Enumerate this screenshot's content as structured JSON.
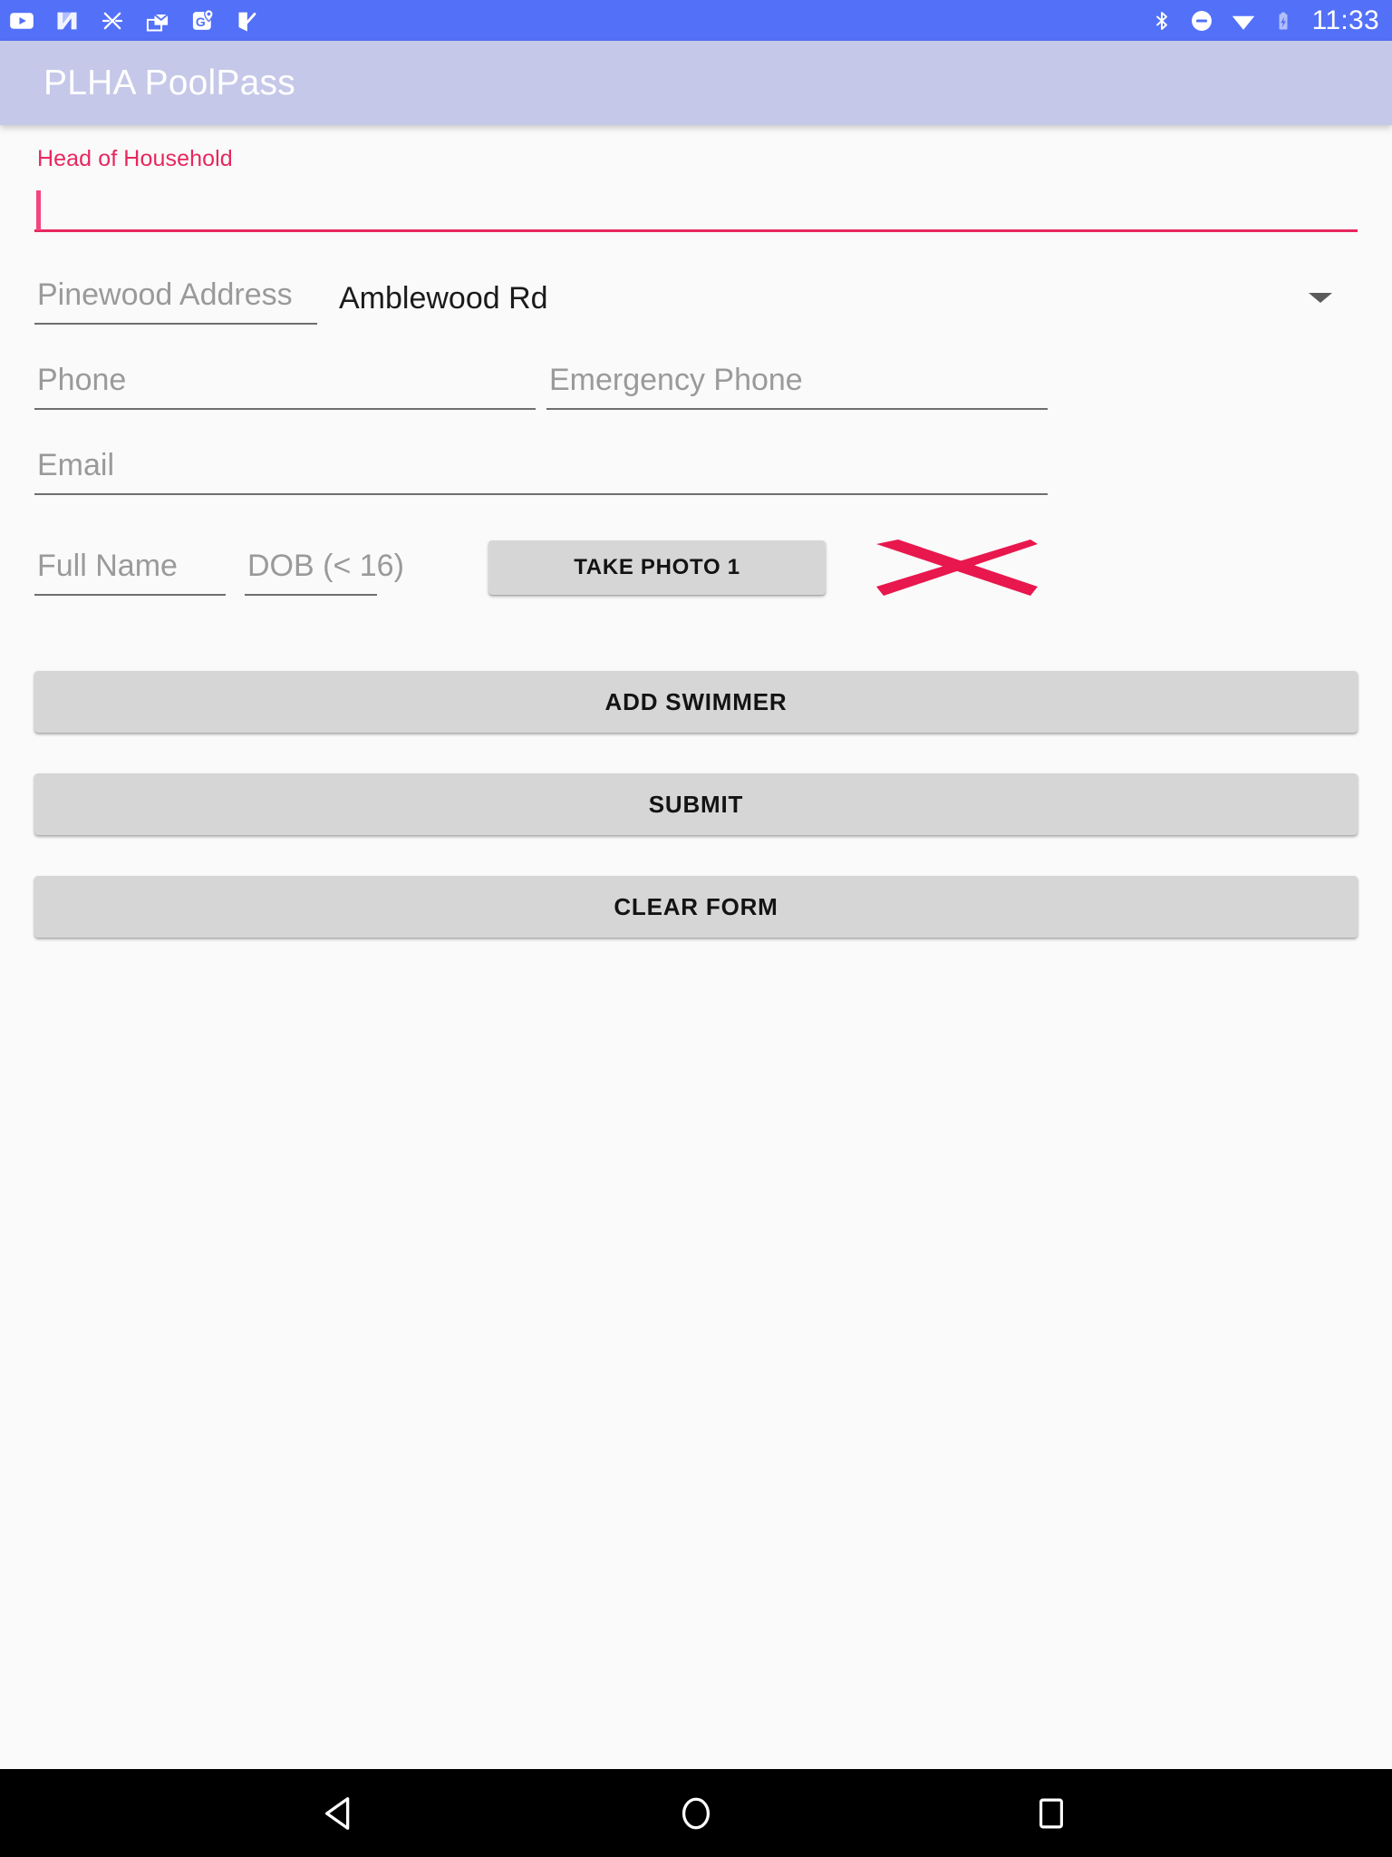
{
  "status_bar": {
    "background_color": "#5370F8",
    "time": "11:33",
    "left_icons": [
      "youtube-icon",
      "nova-n-icon",
      "crossed-x-icon",
      "mail-open-icon",
      "maps-pin-icon",
      "check-flag-icon"
    ],
    "right_icons": [
      "bluetooth-icon",
      "do-not-disturb-icon",
      "wifi-icon",
      "battery-charging-icon"
    ]
  },
  "app_bar": {
    "title": "PLHA PoolPass",
    "background_color": "#C5C8E8",
    "title_color": "#FFFFFF"
  },
  "form": {
    "head_of_household": {
      "label": "Head of Household",
      "value": "",
      "label_color": "#E8275E",
      "underline_color": "#E8275E",
      "focused": true
    },
    "address_number": {
      "placeholder": "Pinewood Address",
      "value": ""
    },
    "street_spinner": {
      "selected": "Amblewood Rd",
      "caret": "chevron-down-icon"
    },
    "phone": {
      "placeholder": "Phone",
      "value": ""
    },
    "emergency_phone": {
      "placeholder": "Emergency Phone",
      "value": ""
    },
    "email": {
      "placeholder": "Email",
      "value": ""
    },
    "swimmer_row": {
      "full_name": {
        "placeholder": "Full Name",
        "value": ""
      },
      "dob": {
        "placeholder": "DOB (< 16)",
        "value": ""
      },
      "take_photo_label": "TAKE PHOTO 1",
      "delete_icon": "delete-x-icon",
      "delete_icon_color": "#E8174D"
    }
  },
  "actions": {
    "add_swimmer": "ADD SWIMMER",
    "submit": "SUBMIT",
    "clear_form": "CLEAR FORM",
    "button_color": "#D6D6D6"
  },
  "nav_bar": {
    "background_color": "#000000",
    "buttons": [
      "back-icon",
      "home-icon",
      "recents-icon"
    ]
  }
}
